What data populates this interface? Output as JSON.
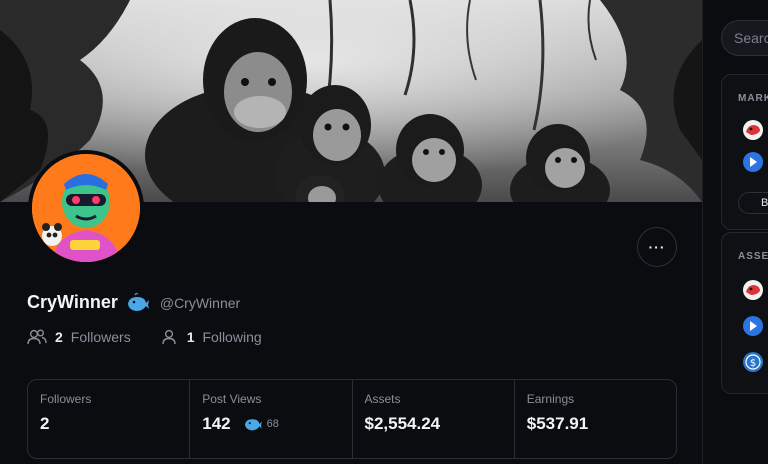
{
  "profile": {
    "display_name": "CryWinner",
    "handle": "@CryWinner",
    "followers_count": "2",
    "followers_label": "Followers",
    "following_count": "1",
    "following_label": "Following"
  },
  "more_button": {
    "label": "···"
  },
  "stats": [
    {
      "label": "Followers",
      "value": "2"
    },
    {
      "label": "Post Views",
      "value": "142",
      "sub_value": "68"
    },
    {
      "label": "Assets",
      "value": "$2,554.24"
    },
    {
      "label": "Earnings",
      "value": "$537.91"
    }
  ],
  "sidebar": {
    "search_placeholder": "Search",
    "markets_title": "MARKETS",
    "markets_button": "Buy",
    "assets_title": "ASSETS"
  },
  "colors": {
    "background": "#0b0c10",
    "avatar_bg": "#ff7a1a",
    "whale": "#4aa8e8",
    "coin_blue": "#2b74e2",
    "usdc": "#2775ca"
  },
  "icons": [
    "whale-icon",
    "users-icon",
    "user-icon",
    "more-icon",
    "search-icon",
    "coin-icon",
    "usdc-icon"
  ]
}
